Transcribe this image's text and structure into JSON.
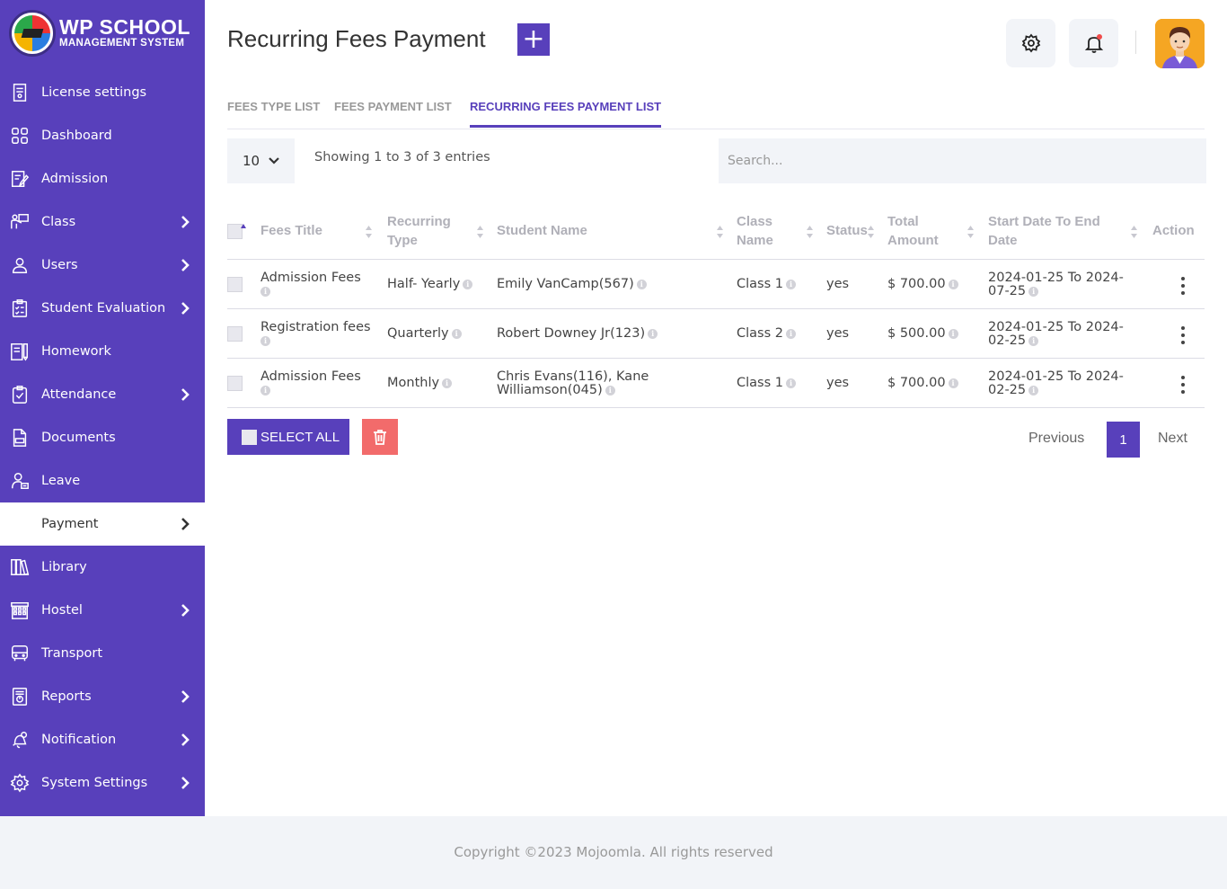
{
  "brand": {
    "title": "WP SCHOOL",
    "subtitle": "MANAGEMENT SYSTEM",
    "accent": "#5840bb"
  },
  "sidebar": {
    "items": [
      {
        "label": "License settings",
        "icon": "license-icon",
        "chevron": false
      },
      {
        "label": "Dashboard",
        "icon": "dashboard-icon",
        "chevron": false
      },
      {
        "label": "Admission",
        "icon": "admission-icon",
        "chevron": false
      },
      {
        "label": "Class",
        "icon": "class-icon",
        "chevron": true
      },
      {
        "label": "Users",
        "icon": "users-icon",
        "chevron": true
      },
      {
        "label": "Student Evaluation",
        "icon": "evaluation-icon",
        "chevron": true
      },
      {
        "label": "Homework",
        "icon": "homework-icon",
        "chevron": false
      },
      {
        "label": "Attendance",
        "icon": "attendance-icon",
        "chevron": true
      },
      {
        "label": "Documents",
        "icon": "documents-icon",
        "chevron": false
      },
      {
        "label": "Leave",
        "icon": "leave-icon",
        "chevron": false
      },
      {
        "label": "Payment",
        "icon": "payment-icon",
        "chevron": true,
        "active": true
      },
      {
        "label": "Library",
        "icon": "library-icon",
        "chevron": false
      },
      {
        "label": "Hostel",
        "icon": "hostel-icon",
        "chevron": true
      },
      {
        "label": "Transport",
        "icon": "transport-icon",
        "chevron": false
      },
      {
        "label": "Reports",
        "icon": "reports-icon",
        "chevron": true
      },
      {
        "label": "Notification",
        "icon": "notification-icon",
        "chevron": true
      },
      {
        "label": "System Settings",
        "icon": "system-settings-icon",
        "chevron": true
      }
    ]
  },
  "header": {
    "title": "Recurring Fees Payment",
    "add_icon": "+"
  },
  "tabs": [
    {
      "label": "FEES TYPE LIST",
      "active": false
    },
    {
      "label": "FEES PAYMENT LIST",
      "active": false
    },
    {
      "label": "RECURRING FEES PAYMENT LIST",
      "active": true
    }
  ],
  "controls": {
    "page_length": "10",
    "info": "Showing 1 to 3 of 3 entries",
    "search_placeholder": "Search..."
  },
  "table": {
    "columns": [
      "Fees Title",
      "Recurring Type",
      "Student Name",
      "Class Name",
      "Status",
      "Total Amount",
      "Start Date To End Date",
      "Action"
    ],
    "rows": [
      {
        "fees_title": "Admission Fees",
        "recurring_type": "Half- Yearly",
        "student_name": "Emily VanCamp(567)",
        "class_name": "Class 1",
        "status": "yes",
        "total_amount": "$ 700.00",
        "dates": "2024-01-25 To 2024-07-25"
      },
      {
        "fees_title": "Registration fees",
        "recurring_type": "Quarterly",
        "student_name": "Robert Downey Jr(123)",
        "class_name": "Class 2",
        "status": "yes",
        "total_amount": "$ 500.00",
        "dates": "2024-01-25 To 2024-02-25"
      },
      {
        "fees_title": "Admission Fees",
        "recurring_type": "Monthly",
        "student_name": "Chris Evans(116), Kane Williamson(045)",
        "class_name": "Class 1",
        "status": "yes",
        "total_amount": "$ 700.00",
        "dates": "2024-01-25 To 2024-02-25"
      }
    ]
  },
  "actions": {
    "select_all": "SELECT ALL"
  },
  "pagination": {
    "previous": "Previous",
    "current": "1",
    "next": "Next"
  },
  "footer": {
    "text": "Copyright ©2023 Mojoomla. All rights reserved"
  }
}
